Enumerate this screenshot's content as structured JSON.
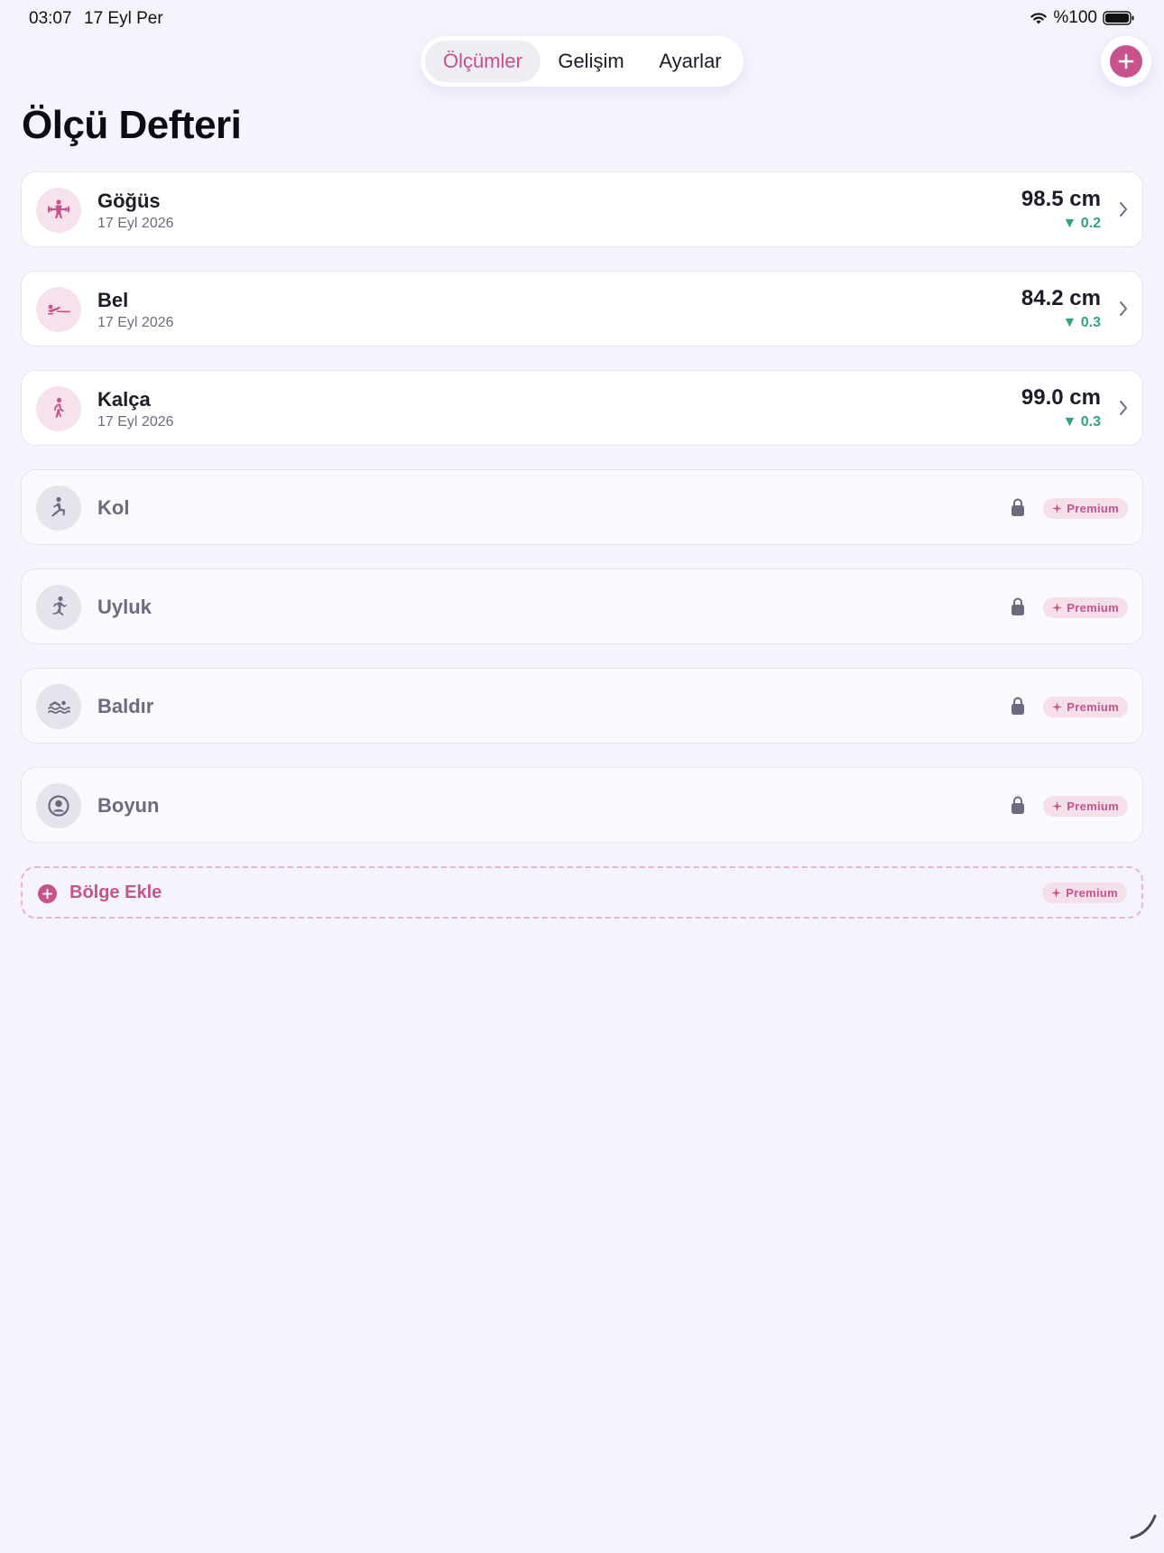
{
  "status_bar": {
    "time": "03:07",
    "date": "17 Eyl Per",
    "battery": "%100",
    "wifi_icon": "wifi-icon",
    "battery_icon": "battery-icon"
  },
  "tabs": [
    {
      "label": "Ölçümler",
      "active": true
    },
    {
      "label": "Gelişim",
      "active": false
    },
    {
      "label": "Ayarlar",
      "active": false
    }
  ],
  "add_button_icon": "plus-icon",
  "title": "Ölçü Defteri",
  "measurements": [
    {
      "name": "Göğüs",
      "date": "17 Eyl 2026",
      "value": "98.5 cm",
      "delta": "▼ 0.2",
      "icon": "weightlifting-icon"
    },
    {
      "name": "Bel",
      "date": "17 Eyl 2026",
      "value": "84.2 cm",
      "delta": "▼ 0.3",
      "icon": "waist-exercise-icon"
    },
    {
      "name": "Kalça",
      "date": "17 Eyl 2026",
      "value": "99.0 cm",
      "delta": "▼ 0.3",
      "icon": "walking-icon"
    }
  ],
  "locked": [
    {
      "name": "Kol",
      "badge": "Premium",
      "icon": "lunge-icon"
    },
    {
      "name": "Uyluk",
      "badge": "Premium",
      "icon": "running-icon"
    },
    {
      "name": "Baldır",
      "badge": "Premium",
      "icon": "swimming-icon"
    },
    {
      "name": "Boyun",
      "badge": "Premium",
      "icon": "person-circle-icon"
    }
  ],
  "add_region": {
    "label": "Bölge Ekle",
    "badge": "Premium"
  },
  "colors": {
    "accent": "#c8538c",
    "background": "#f5f4fd",
    "positive": "#2fa57a",
    "badge_bg": "#f5dfe9"
  }
}
